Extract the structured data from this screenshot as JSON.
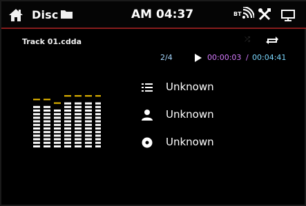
{
  "header": {
    "source_label": "Disc",
    "clock": "AM 04:37",
    "bt_label": "BT"
  },
  "track": {
    "filename": "Track 01.cdda",
    "position": "2/4",
    "elapsed": "00:00:03",
    "separator": "/",
    "total": "00:04:41"
  },
  "info": {
    "title": "Unknown",
    "artist": "Unknown",
    "album": "Unknown"
  },
  "equalizer": {
    "band_levels": [
      12,
      12,
      11,
      13,
      13,
      13,
      13
    ],
    "max_level": 14
  },
  "icons": {
    "home": "home-icon",
    "folder": "folder-icon",
    "bluetooth": "bluetooth-icon",
    "settings": "tools-icon",
    "display": "display-icon",
    "shuffle": "shuffle-icon",
    "repeat": "repeat-icon",
    "play": "play-icon",
    "list": "list-icon",
    "artist": "person-icon",
    "album": "disc-icon"
  },
  "colors": {
    "accent_red": "#8a1d1d",
    "eq_bar": "#ffffff",
    "eq_peak": "#f2c200",
    "time_elapsed": "#d67bff",
    "time_total": "#7bd8ff"
  }
}
